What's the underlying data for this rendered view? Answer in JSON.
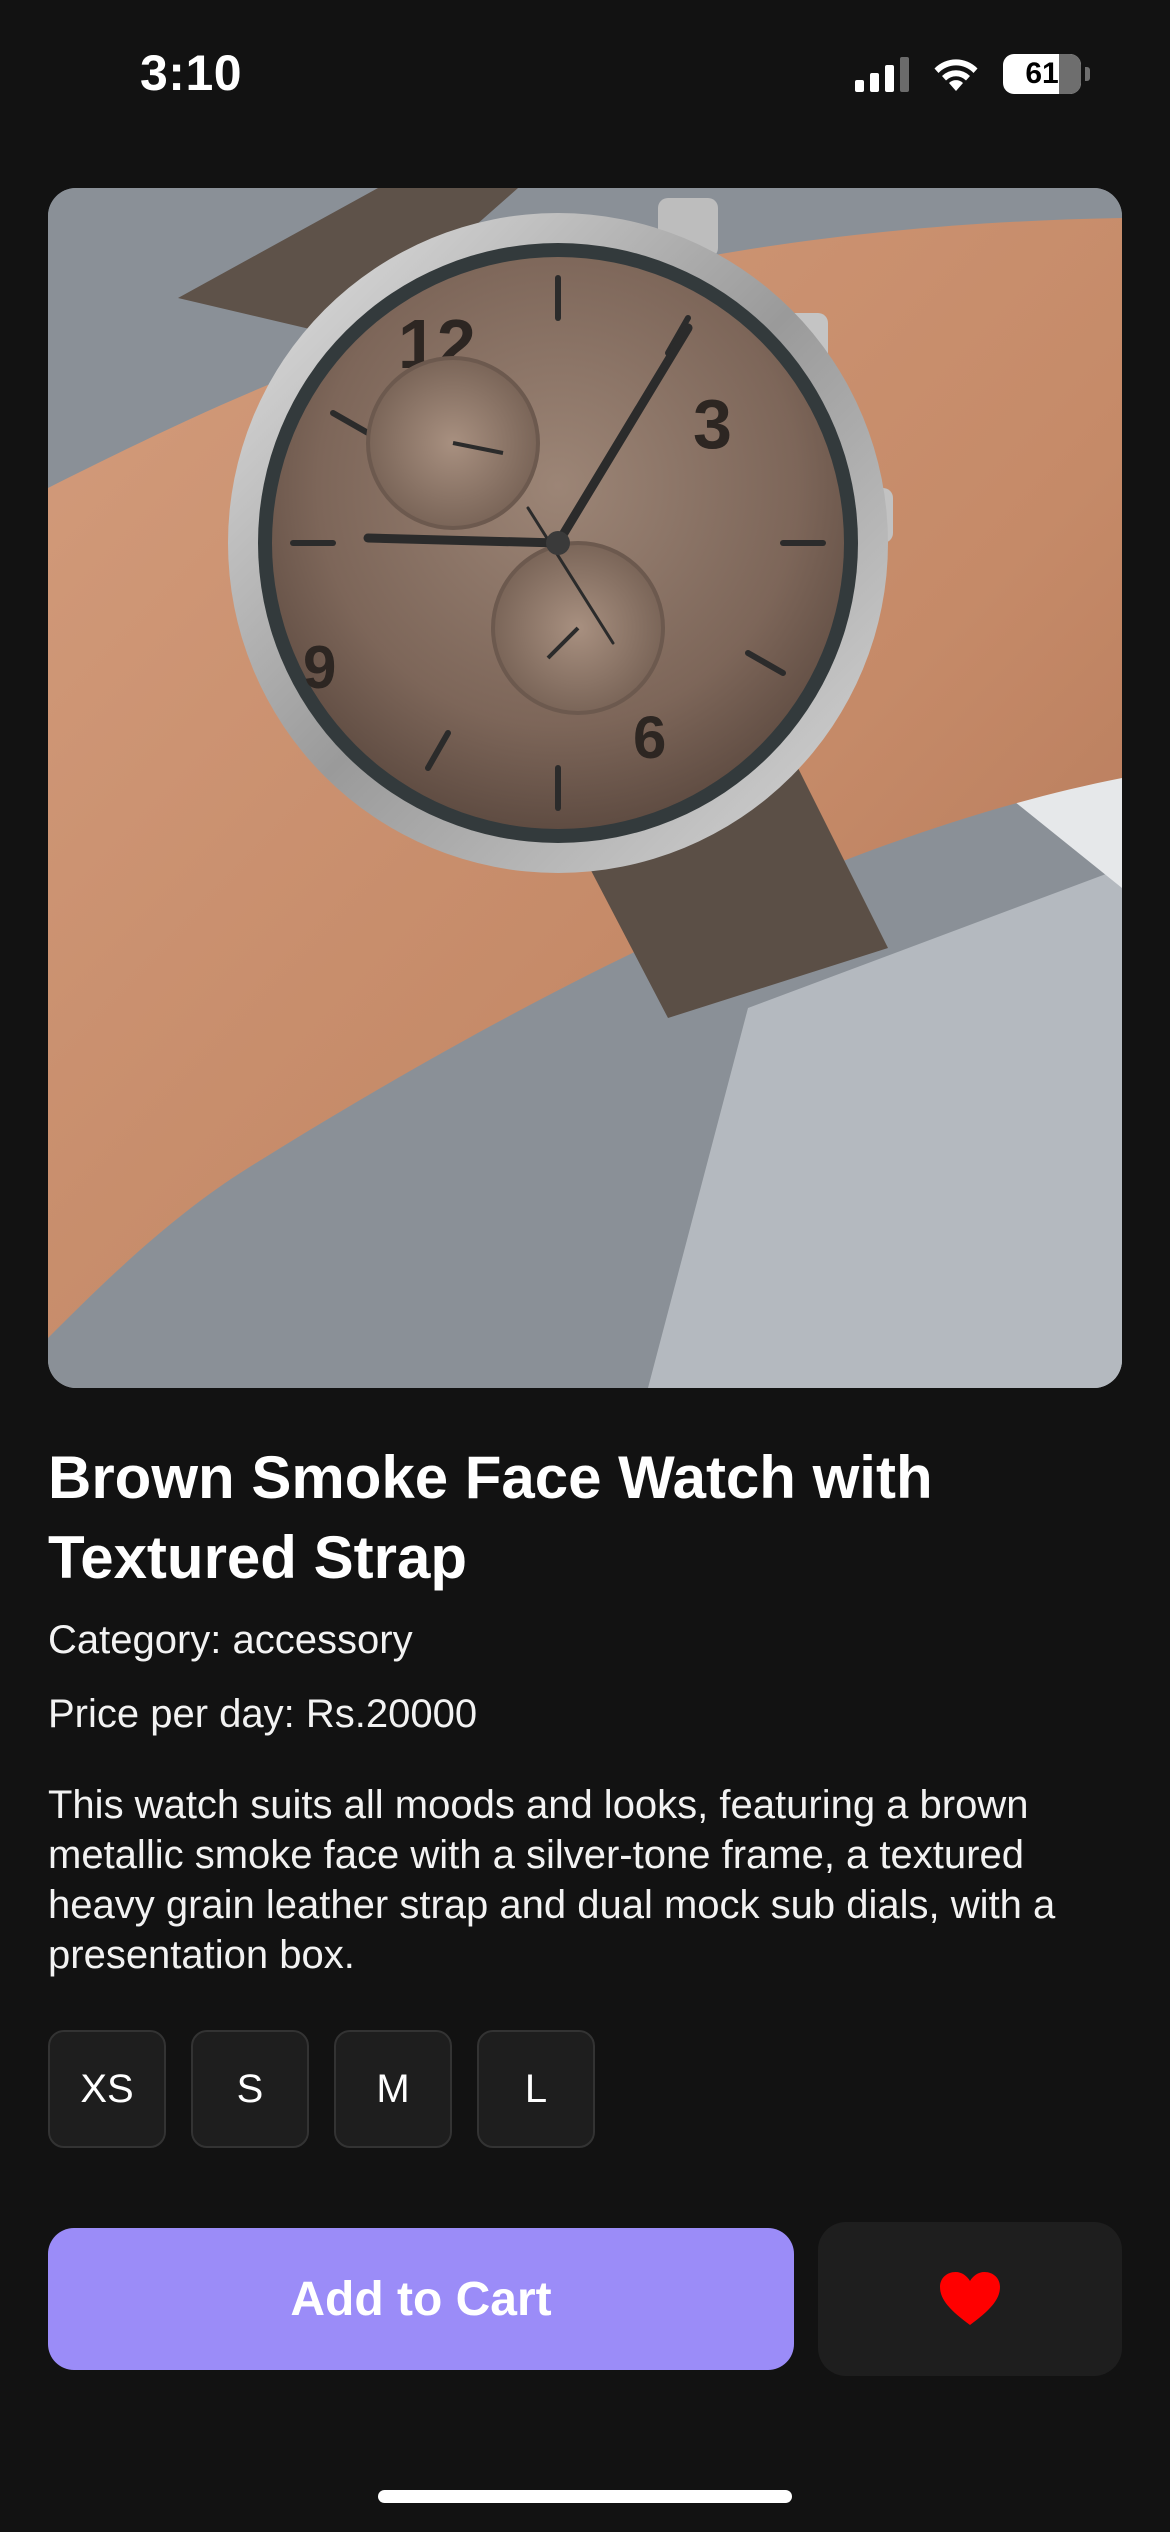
{
  "status_bar": {
    "time": "3:10",
    "battery_level": "61",
    "signal_icon": "cellular-signal-icon",
    "wifi_icon": "wifi-icon",
    "battery_icon": "battery-icon"
  },
  "product": {
    "image_icon": "watch-photo",
    "title": "Brown Smoke Face Watch with Textured Strap",
    "category": "Category: accessory",
    "price": "Price per day: Rs.20000",
    "description": "This watch suits all moods and looks, featuring a brown metallic smoke face with a silver-tone frame, a textured heavy grain leather strap and dual mock sub dials, with a presentation box."
  },
  "sizes": [
    "XS",
    "S",
    "M",
    "L"
  ],
  "actions": {
    "add_to_cart_label": "Add to Cart",
    "favorite_icon": "heart-icon"
  },
  "colors": {
    "background": "#121212",
    "accent": "#9b8cf8",
    "heart": "#ff0000",
    "chip_background": "#1e1e1e"
  }
}
